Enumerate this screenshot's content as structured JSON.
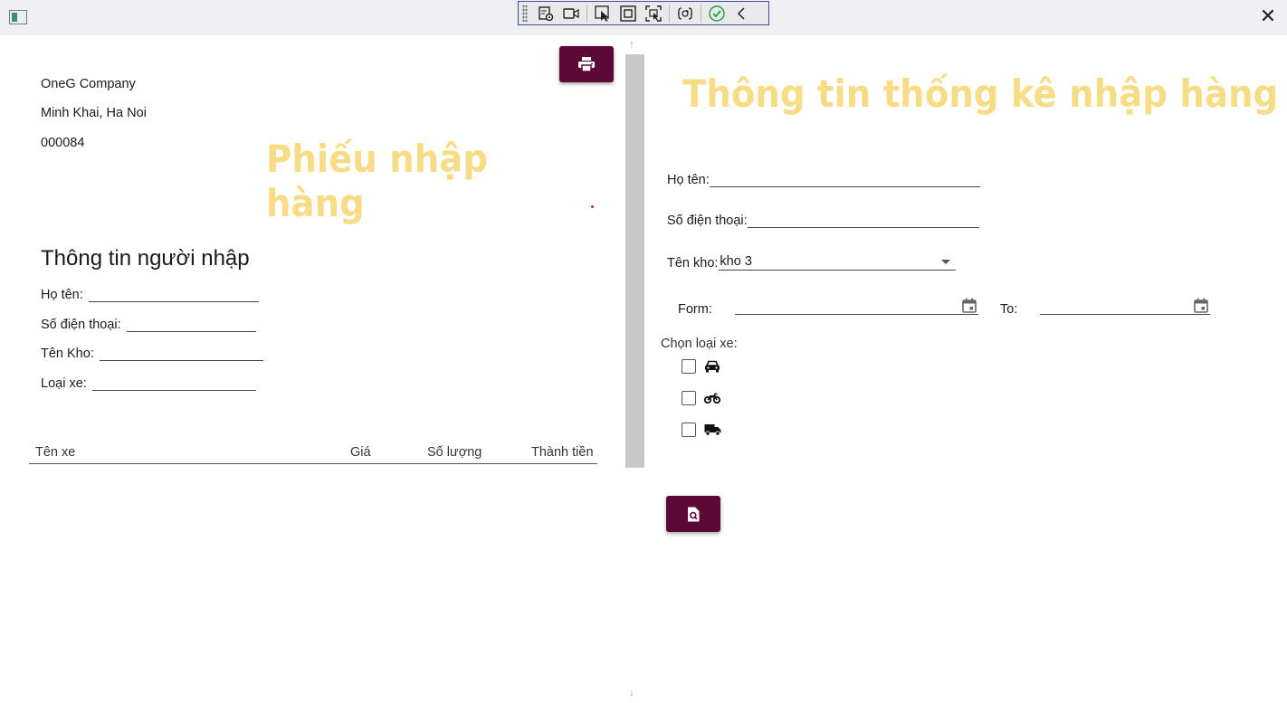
{
  "window": {
    "close_glyph": "✕",
    "app_icon": "app-window-icon"
  },
  "debug_toolbar": {
    "tools": [
      {
        "name": "select-element-icon"
      },
      {
        "name": "video-icon"
      },
      {
        "name": "cursor-select-icon"
      },
      {
        "name": "layout-bounds-icon"
      },
      {
        "name": "track-focus-icon"
      },
      {
        "name": "hot-reload-icon"
      },
      {
        "name": "check-status-icon"
      },
      {
        "name": "collapse-chevron-icon"
      }
    ],
    "colors": {
      "border": "#3a4fa3",
      "check": "#2e9c3f"
    }
  },
  "receipt": {
    "company": "OneG Company",
    "address": "Minh Khai, Ha Noi",
    "code": "000084",
    "title": "Phiếu nhập hàng",
    "print_icon": "print-icon",
    "importer_heading": "Thông tin người nhập",
    "fields": {
      "name": "Họ tên:",
      "phone": "Số điện thoại:",
      "warehouse": "Tên Kho:",
      "vehicle": "Loại xe:"
    },
    "table_headers": {
      "name": "Tên xe",
      "price": "Giá",
      "qty": "Số lượng",
      "total": "Thành tiền"
    }
  },
  "stats": {
    "title": "Thông tin thống kê nhập hàng",
    "name_label": "Họ tên:",
    "phone_label": "Số điện thoại:",
    "warehouse_label": "Tên kho:",
    "warehouse_value": "kho 3",
    "from_label": "Form:",
    "to_label": "To:",
    "vehicle_type_label": "Chọn loại xe:",
    "vehicle_types": [
      {
        "icon": "car-icon",
        "checked": false
      },
      {
        "icon": "motorbike-icon",
        "checked": false
      },
      {
        "icon": "truck-icon",
        "checked": false
      }
    ],
    "search_icon": "search-document-icon"
  },
  "colors": {
    "accent_button": "#5b0a38",
    "title_yellow": "#f7dc85",
    "titlebar_bg": "#f0eff3",
    "scroll_thumb": "#c8c8c8"
  }
}
